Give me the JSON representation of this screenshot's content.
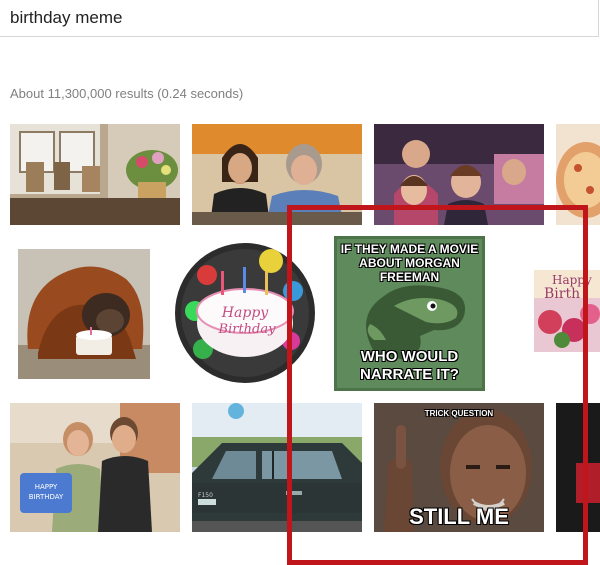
{
  "search": {
    "query": "birthday meme"
  },
  "stats": {
    "text": "About 11,300,000 results (0.24 seconds)"
  },
  "results": {
    "raptor_top": "IF THEY MADE A MOVIE ABOUT MORGAN FREEMAN",
    "raptor_bottom": "WHO WOULD NARRATE IT?",
    "freeman_top": "TRICK QUESTION",
    "freeman_bottom": "STILL ME"
  },
  "colors": {
    "highlight": "#c0161b",
    "raptor_bg": "#5f8a5c",
    "link_gray": "#808080"
  }
}
